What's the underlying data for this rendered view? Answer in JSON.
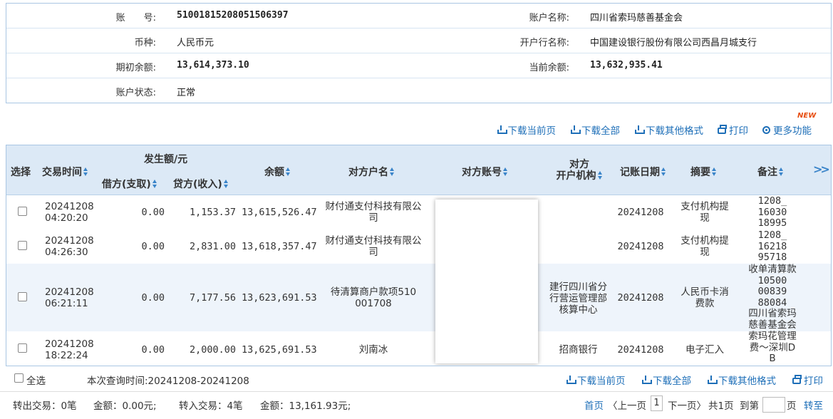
{
  "account_info": {
    "account_no_label": "账　　号:",
    "account_no": "51001815208051506397",
    "account_name_label": "账户名称:",
    "account_name": "四川省索玛慈善基金会",
    "currency_label": "币种:",
    "currency": "人民币元",
    "bank_label": "开户行名称:",
    "bank": "中国建设银行股份有限公司西昌月城支行",
    "opening_balance_label": "期初余额:",
    "opening_balance": "13,614,373.10",
    "current_balance_label": "当前余额:",
    "current_balance": "13,632,935.41",
    "status_label": "账户状态:",
    "status": "正常"
  },
  "toolbar": {
    "download_page": "下载当前页",
    "download_all": "下载全部",
    "download_other": "下载其他格式",
    "print": "打印",
    "more": "更多功能",
    "new_badge": "NEW"
  },
  "table": {
    "headers": {
      "select": "选择",
      "time": "交易时间",
      "amount_group": "发生额/元",
      "debit": "借方(支取)",
      "credit": "贷方(收入)",
      "balance": "余额",
      "counterparty_name": "对方户名",
      "counterparty_account": "对方账号",
      "counterparty_bank_1": "对方",
      "counterparty_bank_2": "开户机构",
      "posting_date": "记账日期",
      "summary": "摘要",
      "remark": "备注",
      "expand": "»"
    },
    "rows": [
      {
        "date": "20241208",
        "time": "04:20:20",
        "debit": "0.00",
        "credit": "1,153.37",
        "balance": "13,615,526.47",
        "name_1": "财付通支付科技有限公",
        "name_2": "司",
        "bank_1": "",
        "bank_2": "",
        "bank_3": "",
        "posting_date": "20241208",
        "summary_1": "支付机构提",
        "summary_2": "现",
        "remark_1": "1208_",
        "remark_2": "16030",
        "remark_3": "18995"
      },
      {
        "date": "20241208",
        "time": "04:26:30",
        "debit": "0.00",
        "credit": "2,831.00",
        "balance": "13,618,357.47",
        "name_1": "财付通支付科技有限公",
        "name_2": "司",
        "bank_1": "",
        "bank_2": "",
        "bank_3": "",
        "posting_date": "20241208",
        "summary_1": "支付机构提",
        "summary_2": "现",
        "remark_1": "1208_",
        "remark_2": "16218",
        "remark_3": "95718"
      },
      {
        "date": "20241208",
        "time": "06:21:11",
        "debit": "0.00",
        "credit": "7,177.56",
        "balance": "13,623,691.53",
        "name_1": "待清算商户款项510",
        "name_2": "001708",
        "bank_1": "建行四川省分",
        "bank_2": "行营运管理部",
        "bank_3": "核算中心",
        "posting_date": "20241208",
        "summary_1": "人民币卡消",
        "summary_2": "费款",
        "remark_1": "收单清算款",
        "remark_2": "10500",
        "remark_3": "00839",
        "remark_4": "88084",
        "remark_5": "四川省索玛",
        "remark_6": "慈善基金会"
      },
      {
        "date": "20241208",
        "time": "18:22:24",
        "debit": "0.00",
        "credit": "2,000.00",
        "balance": "13,625,691.53",
        "name_1": "刘南冰",
        "name_2": "",
        "bank_1": "招商银行",
        "bank_2": "",
        "bank_3": "",
        "posting_date": "20241208",
        "summary_1": "电子汇入",
        "summary_2": "",
        "remark_1": "索玛花管理",
        "remark_2": "费～深圳D",
        "remark_3": "B"
      }
    ]
  },
  "footer": {
    "select_all": "全选",
    "query_time": "本次查询时间:20241208-20241208",
    "download_page": "下载当前页",
    "download_all": "下载全部",
    "download_other": "下载其他格式",
    "print": "打印",
    "out_count": "转出交易：0笔",
    "out_amount": "金额：0.00元;",
    "in_count": "转入交易：4笔",
    "in_amount": "金额：13,161.93元;",
    "first": "首页",
    "prev": "〈上一页",
    "page": "1",
    "next": "下一页〉",
    "total": "共1页",
    "goto": "到第",
    "page_unit": "页",
    "go": "转至"
  },
  "colors": {
    "link": "#1e6fb8",
    "header_bg": "#dce9f6",
    "row_alt": "#eef4fb",
    "border": "#a9c6e3"
  }
}
